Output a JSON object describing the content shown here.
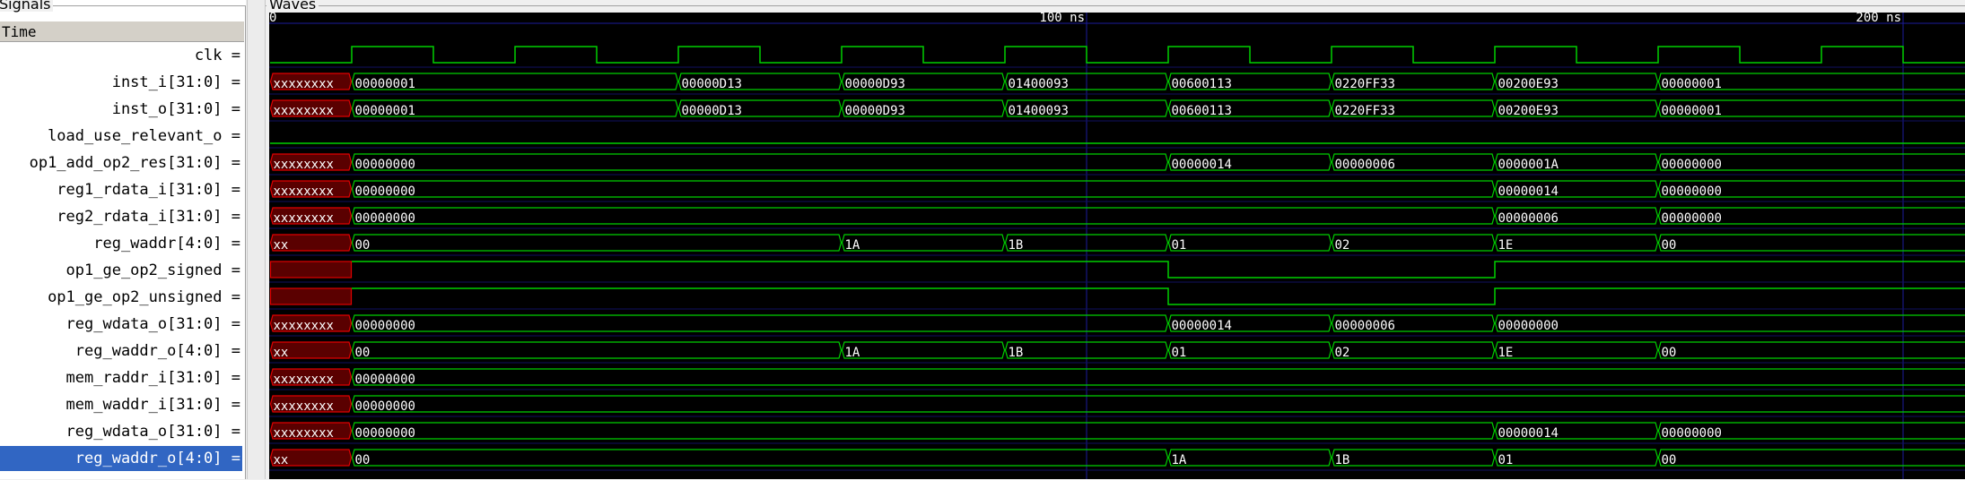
{
  "signals_panel": {
    "title": "Signals",
    "time_header": "Time",
    "signals": [
      {
        "name": "clk =",
        "row": 1
      },
      {
        "name": "inst_i[31:0] =",
        "row": 2
      },
      {
        "name": "inst_o[31:0] =",
        "row": 3
      },
      {
        "name": "load_use_relevant_o =",
        "row": 4
      },
      {
        "name": "op1_add_op2_res[31:0] =",
        "row": 5
      },
      {
        "name": "reg1_rdata_i[31:0] =",
        "row": 6
      },
      {
        "name": "reg2_rdata_i[31:0] =",
        "row": 7
      },
      {
        "name": "reg_waddr[4:0] =",
        "row": 8
      },
      {
        "name": "op1_ge_op2_signed =",
        "row": 9
      },
      {
        "name": "op1_ge_op2_unsigned =",
        "row": 10
      },
      {
        "name": "reg_wdata_o[31:0] =",
        "row": 11
      },
      {
        "name": "reg_waddr_o[4:0] =",
        "row": 12
      },
      {
        "name": "mem_raddr_i[31:0] =",
        "row": 13
      },
      {
        "name": "mem_waddr_i[31:0] =",
        "row": 14
      },
      {
        "name": "reg_wdata_o[31:0] =",
        "row": 15
      },
      {
        "name": "reg_waddr_o[4:0] =",
        "row": 16,
        "selected": true
      }
    ]
  },
  "waves_panel": {
    "title": "Waves",
    "time_ticks": [
      {
        "t": 0,
        "label": "0"
      },
      {
        "t": 100,
        "label": "100 ns"
      },
      {
        "t": 200,
        "label": "200 ns"
      }
    ],
    "time_range_ns": [
      0,
      208
    ],
    "colors": {
      "wave": "#00d000",
      "unknown": "#e00000",
      "unknown_fill": "#5a0000",
      "text": "#ffffff",
      "grid": "#1c1c9c",
      "background": "#000000"
    },
    "clock": {
      "row": 1,
      "period_ns": 20,
      "first_rise_ns": 10
    },
    "traces": [
      {
        "row": 2,
        "segments": [
          [
            0,
            10,
            "xxxxxxxx",
            "x"
          ],
          [
            10,
            50,
            "00000001"
          ],
          [
            50,
            70,
            "00000D13"
          ],
          [
            70,
            90,
            "00000D93"
          ],
          [
            90,
            110,
            "01400093"
          ],
          [
            110,
            130,
            "00600113"
          ],
          [
            130,
            150,
            "0220FF33"
          ],
          [
            150,
            170,
            "00200E93"
          ],
          [
            170,
            208,
            "00000001"
          ]
        ]
      },
      {
        "row": 3,
        "segments": [
          [
            0,
            10,
            "xxxxxxxx",
            "x"
          ],
          [
            10,
            50,
            "00000001"
          ],
          [
            50,
            70,
            "00000D13"
          ],
          [
            70,
            90,
            "00000D93"
          ],
          [
            90,
            110,
            "01400093"
          ],
          [
            110,
            130,
            "00600113"
          ],
          [
            130,
            150,
            "0220FF33"
          ],
          [
            150,
            170,
            "00200E93"
          ],
          [
            170,
            208,
            "00000001"
          ]
        ]
      },
      {
        "row": 4,
        "level": [
          [
            0,
            208,
            0
          ]
        ]
      },
      {
        "row": 5,
        "segments": [
          [
            0,
            10,
            "xxxxxxxx",
            "x"
          ],
          [
            10,
            110,
            "00000000"
          ],
          [
            110,
            130,
            "00000014"
          ],
          [
            130,
            150,
            "00000006"
          ],
          [
            150,
            170,
            "0000001A"
          ],
          [
            170,
            208,
            "00000000"
          ]
        ]
      },
      {
        "row": 6,
        "segments": [
          [
            0,
            10,
            "xxxxxxxx",
            "x"
          ],
          [
            10,
            150,
            "00000000"
          ],
          [
            150,
            170,
            "00000014"
          ],
          [
            170,
            208,
            "00000000"
          ]
        ]
      },
      {
        "row": 7,
        "segments": [
          [
            0,
            10,
            "xxxxxxxx",
            "x"
          ],
          [
            10,
            150,
            "00000000"
          ],
          [
            150,
            170,
            "00000006"
          ],
          [
            170,
            208,
            "00000000"
          ]
        ]
      },
      {
        "row": 8,
        "segments": [
          [
            0,
            10,
            "xx",
            "x"
          ],
          [
            10,
            70,
            "00"
          ],
          [
            70,
            90,
            "1A"
          ],
          [
            90,
            110,
            "1B"
          ],
          [
            110,
            130,
            "01"
          ],
          [
            130,
            150,
            "02"
          ],
          [
            150,
            170,
            "1E"
          ],
          [
            170,
            208,
            "00"
          ]
        ]
      },
      {
        "row": 9,
        "unknown": [
          0,
          10
        ],
        "level": [
          [
            10,
            110,
            1
          ],
          [
            110,
            150,
            0
          ],
          [
            150,
            208,
            1
          ]
        ]
      },
      {
        "row": 10,
        "unknown": [
          0,
          10
        ],
        "level": [
          [
            10,
            110,
            1
          ],
          [
            110,
            150,
            0
          ],
          [
            150,
            208,
            1
          ]
        ]
      },
      {
        "row": 11,
        "segments": [
          [
            0,
            10,
            "xxxxxxxx",
            "x"
          ],
          [
            10,
            110,
            "00000000"
          ],
          [
            110,
            130,
            "00000014"
          ],
          [
            130,
            150,
            "00000006"
          ],
          [
            150,
            208,
            "00000000"
          ]
        ]
      },
      {
        "row": 12,
        "segments": [
          [
            0,
            10,
            "xx",
            "x"
          ],
          [
            10,
            70,
            "00"
          ],
          [
            70,
            90,
            "1A"
          ],
          [
            90,
            110,
            "1B"
          ],
          [
            110,
            130,
            "01"
          ],
          [
            130,
            150,
            "02"
          ],
          [
            150,
            170,
            "1E"
          ],
          [
            170,
            208,
            "00"
          ]
        ]
      },
      {
        "row": 13,
        "segments": [
          [
            0,
            10,
            "xxxxxxxx",
            "x"
          ],
          [
            10,
            208,
            "00000000"
          ]
        ]
      },
      {
        "row": 14,
        "segments": [
          [
            0,
            10,
            "xxxxxxxx",
            "x"
          ],
          [
            10,
            208,
            "00000000"
          ]
        ]
      },
      {
        "row": 15,
        "segments": [
          [
            0,
            10,
            "xxxxxxxx",
            "x"
          ],
          [
            10,
            150,
            "00000000"
          ],
          [
            150,
            170,
            "00000014"
          ],
          [
            170,
            208,
            "00000000"
          ]
        ]
      },
      {
        "row": 16,
        "segments": [
          [
            0,
            10,
            "xx",
            "x"
          ],
          [
            10,
            110,
            "00"
          ],
          [
            110,
            130,
            "1A"
          ],
          [
            130,
            150,
            "1B"
          ],
          [
            150,
            170,
            "01"
          ],
          [
            170,
            208,
            "00"
          ]
        ]
      }
    ]
  }
}
